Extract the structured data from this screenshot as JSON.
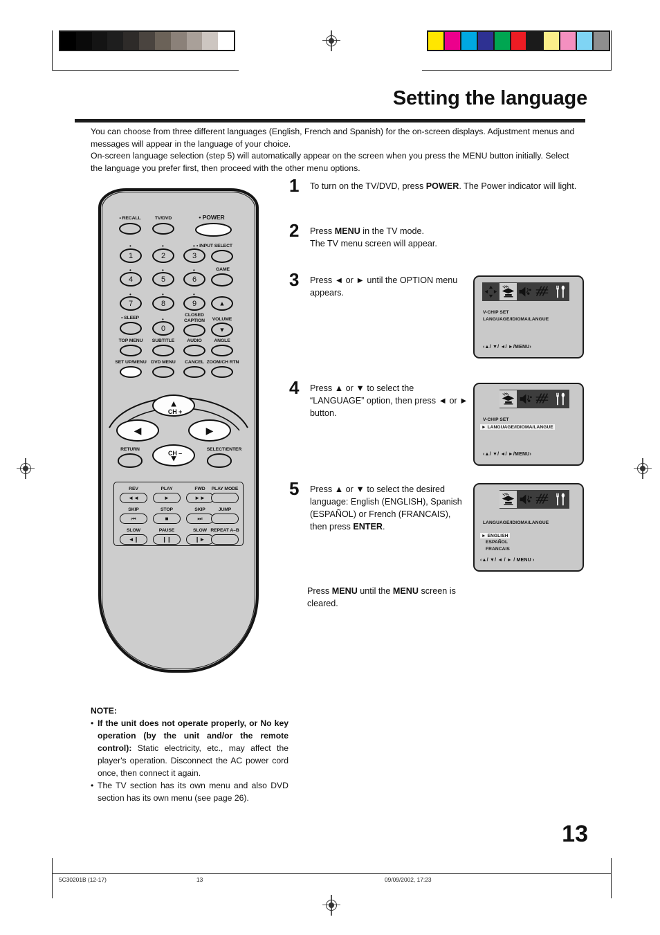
{
  "header": {
    "title": "Setting the language",
    "intro": "You can choose from three different languages (English, French and Spanish) for the on-screen displays. Adjustment menus and messages will appear in the language of your choice.\nOn-screen language selection (step 5) will automatically appear on the screen when you press the MENU button initially. Select the language you prefer first, then proceed with the other menu options."
  },
  "steps": [
    {
      "num": "1",
      "text": "To turn on the TV/DVD, press POWER. The Power indicator will light.",
      "bold_terms": [
        "POWER"
      ]
    },
    {
      "num": "2",
      "text": "Press MENU in the TV mode.\nThe TV menu screen will appear.",
      "bold_terms": [
        "MENU"
      ]
    },
    {
      "num": "3",
      "text": "Press ◄ or ► until the OPTION menu appears.",
      "bold_terms": []
    },
    {
      "num": "4",
      "text": "Press ▲ or ▼ to select the “LANGUAGE” option, then press ◄ or ► button.",
      "bold_terms": []
    },
    {
      "num": "5",
      "text": "Press ▲ or ▼ to select the desired language: English (ENGLISH), Spanish (ESPAÑOL) or French (FRANCAIS), then press ENTER.",
      "bold_terms": [
        "ENTER"
      ]
    }
  ],
  "tail_note": "Press MENU until the MENU screen is cleared.",
  "osd_screens": [
    {
      "name": "option-menu",
      "icons": [
        "position-icon",
        "picture-icon",
        "audio-icon",
        "signal-icon",
        "tools-icon"
      ],
      "selected_icon": "picture-icon",
      "highlight_icon": "tools-icon",
      "lines": [
        "V-CHIP SET",
        "LANGUAGE/IDIOMA/LANGUE"
      ],
      "highlighted_line": null,
      "hint": "‹▲/ ▼/ ◄/ ►/MENU›"
    },
    {
      "name": "language-option-selected",
      "icons": [
        "picture-icon",
        "audio-icon",
        "signal-icon",
        "tools-icon"
      ],
      "selected_icon": "picture-icon",
      "highlight_icon": "tools-icon",
      "lines": [
        "V-CHIP SET",
        "► LANGUAGE/IDIOMA/LANGUE"
      ],
      "highlighted_line": 1,
      "hint": "‹▲/ ▼/ ◄/ ►/MENU›"
    },
    {
      "name": "language-list",
      "icons": [
        "picture-icon",
        "audio-icon",
        "signal-icon",
        "tools-icon"
      ],
      "selected_icon": "picture-icon",
      "highlight_icon": "tools-icon",
      "title": "LANGUAGE/IDIOMA/LANGUE",
      "options": [
        "► ENGLISH",
        "ESPAÑOL",
        "FRANCAIS"
      ],
      "selected_option": 0,
      "hint": "‹▲/ ▼/ ◄ / ► / MENU ›"
    }
  ],
  "remote": {
    "top_row": [
      {
        "label": "• RECALL",
        "name": "recall-button",
        "white": false
      },
      {
        "label": "TV/DVD",
        "name": "tvdvd-button",
        "white": false
      },
      {
        "label": "• POWER",
        "name": "power-button",
        "white": true
      }
    ],
    "keypad": [
      {
        "label": "1",
        "name": "digit-1-button"
      },
      {
        "label": "2",
        "name": "digit-2-button"
      },
      {
        "label": "3",
        "name": "digit-3-button"
      },
      {
        "label": "4",
        "name": "digit-4-button"
      },
      {
        "label": "5",
        "name": "digit-5-button"
      },
      {
        "label": "6",
        "name": "digit-6-button"
      },
      {
        "label": "7",
        "name": "digit-7-button"
      },
      {
        "label": "8",
        "name": "digit-8-button"
      },
      {
        "label": "9",
        "name": "digit-9-button"
      },
      {
        "label": "0",
        "name": "digit-0-button"
      }
    ],
    "right_column": [
      {
        "label": "• INPUT SELECT",
        "name": "input-select-button"
      },
      {
        "label": "GAME",
        "name": "game-button"
      },
      {
        "label": "VOLUME",
        "name": "volume-buttons"
      }
    ],
    "misc_labels": {
      "sleep": "• SLEEP",
      "closed_caption": "CLOSED\nCAPTION",
      "volume": "VOLUME",
      "top_menu": "TOP MENU",
      "subtitle": "SUBTITLE",
      "audio": "AUDIO",
      "angle": "ANGLE",
      "setup_menu": "SET UP/MENU",
      "dvd_menu": "DVD MENU",
      "cancel": "CANCEL",
      "zoom_ch_rtn": "ZOOM/CH RTN"
    },
    "navigation": {
      "ch_up": "CH +",
      "ch_down": "CH –",
      "return": "RETURN",
      "select_enter": "SELECT/ENTER"
    },
    "transport": [
      {
        "label": "REV",
        "glyph": "◄◄",
        "name": "rev-button"
      },
      {
        "label": "PLAY",
        "glyph": "►",
        "name": "play-button"
      },
      {
        "label": "FWD",
        "glyph": "►►",
        "name": "fwd-button"
      },
      {
        "label": "PLAY MODE",
        "glyph": "",
        "name": "play-mode-button"
      },
      {
        "label": "SKIP",
        "glyph": "⏮",
        "name": "skip-back-button"
      },
      {
        "label": "STOP",
        "glyph": "■",
        "name": "stop-button"
      },
      {
        "label": "SKIP",
        "glyph": "⏭",
        "name": "skip-fwd-button"
      },
      {
        "label": "JUMP",
        "glyph": "",
        "name": "jump-button"
      },
      {
        "label": "SLOW",
        "glyph": "◄❙",
        "name": "slow-back-button"
      },
      {
        "label": "PAUSE",
        "glyph": "❙❙",
        "name": "pause-button"
      },
      {
        "label": "SLOW",
        "glyph": "❙►",
        "name": "slow-fwd-button"
      },
      {
        "label": "REPEAT A–B",
        "glyph": "",
        "name": "repeat-ab-button"
      }
    ]
  },
  "note": {
    "heading": "NOTE:",
    "items": [
      {
        "bold": "If the unit does not operate properly, or No key operation (by the unit and/or the remote control):",
        "rest": " Static electricity, etc., may affect the player's operation. Disconnect the AC power cord once, then connect it again."
      },
      {
        "bold": "",
        "rest": "The TV section has its own menu and also DVD section has its own menu (see page 26)."
      }
    ]
  },
  "page_number": "13",
  "footer": {
    "code": "5C30201B (12-17)",
    "page": "13",
    "date": "09/09/2002, 17:23"
  },
  "calibration": {
    "grayscale": [
      "#000000",
      "#0a0a0a",
      "#141414",
      "#1e1e1e",
      "#2e2b29",
      "#4a443f",
      "#6b6258",
      "#8b8179",
      "#a9a099",
      "#cdc6c1",
      "#ffffff"
    ],
    "colors": [
      "#ffe600",
      "#ec008c",
      "#00a8e1",
      "#2e3192",
      "#00a651",
      "#ed1c24",
      "#1b1b1b",
      "#fbef8a",
      "#f490c0",
      "#7fd4f4",
      "#8e8e8e"
    ]
  }
}
